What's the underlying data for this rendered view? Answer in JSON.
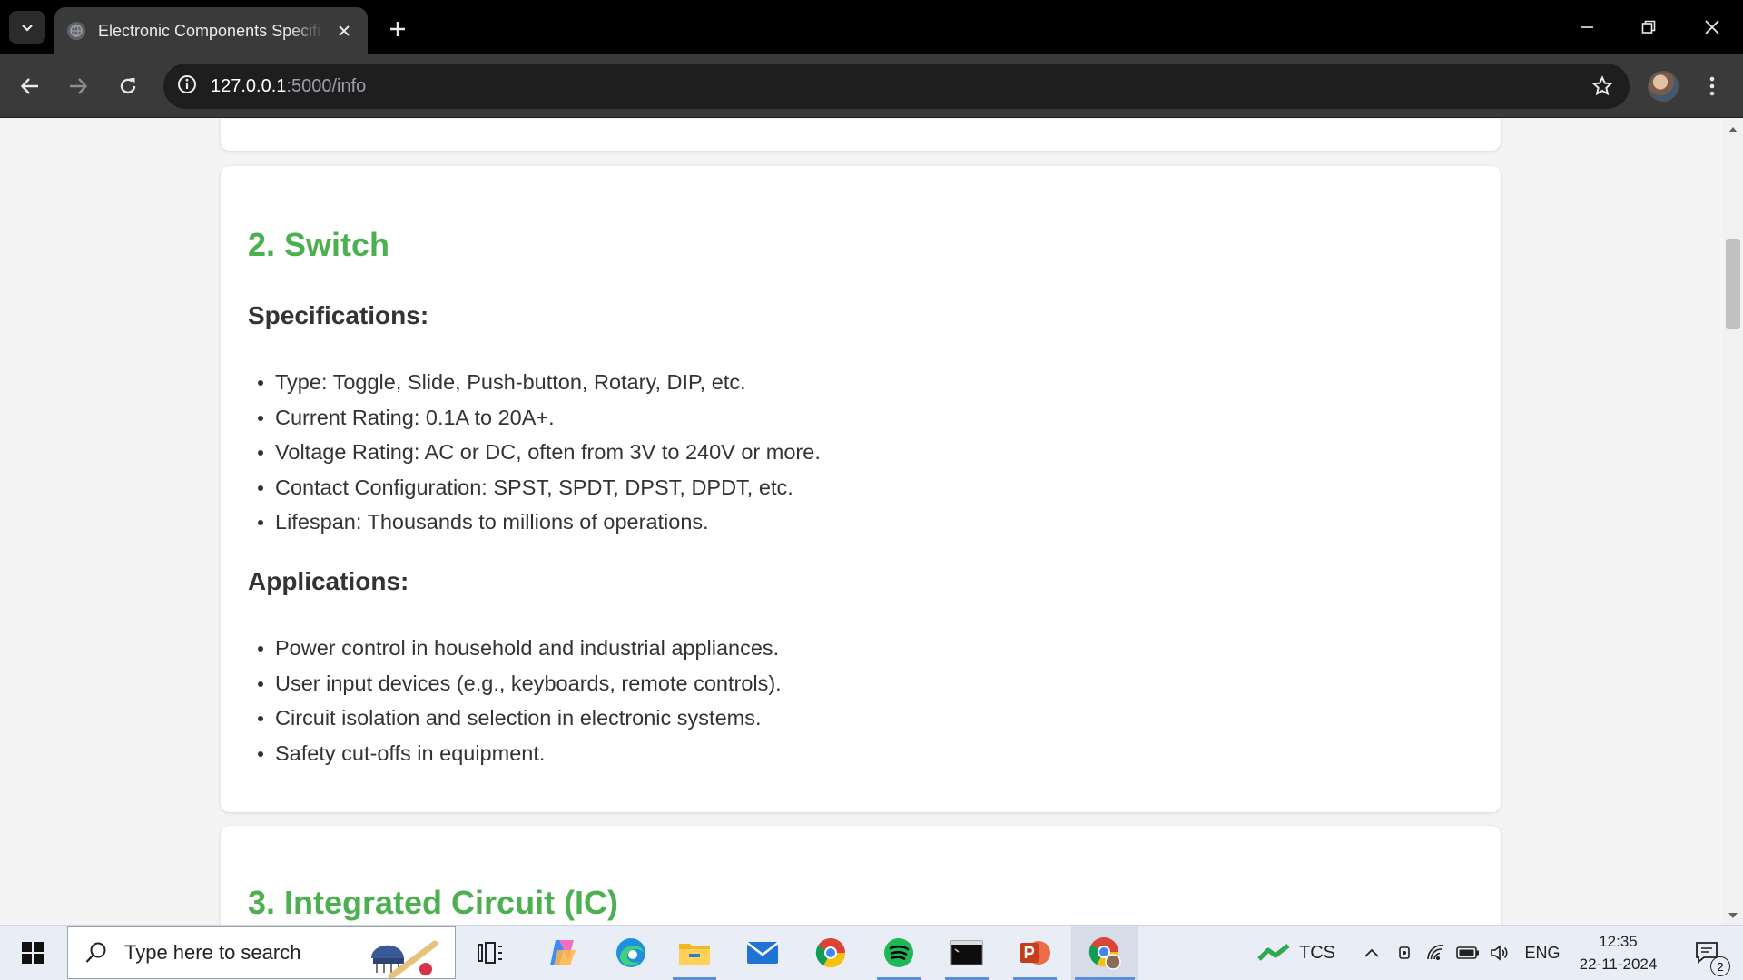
{
  "browser": {
    "tab_title": "Electronic Components Specifications",
    "url_host": "127.0.0.1",
    "url_path": ":5000/info"
  },
  "page": {
    "switch_section": {
      "title": "2. Switch",
      "specs_heading": "Specifications:",
      "specs": [
        "Type: Toggle, Slide, Push-button, Rotary, DIP, etc.",
        "Current Rating: 0.1A to 20A+.",
        "Voltage Rating: AC or DC, often from 3V to 240V or more.",
        "Contact Configuration: SPST, SPDT, DPST, DPDT, etc.",
        "Lifespan: Thousands to millions of operations."
      ],
      "apps_heading": "Applications:",
      "apps": [
        "Power control in household and industrial appliances.",
        "User input devices (e.g., keyboards, remote controls).",
        "Circuit isolation and selection in electronic systems.",
        "Safety cut-offs in equipment."
      ]
    },
    "ic_section": {
      "title": "3. Integrated Circuit (IC)"
    },
    "accent_color": "#4caf50"
  },
  "taskbar": {
    "search_placeholder": "Type here to search",
    "stock_label": "TCS",
    "language": "ENG",
    "time": "12:35",
    "date": "22-11-2024",
    "notification_count": "2"
  }
}
